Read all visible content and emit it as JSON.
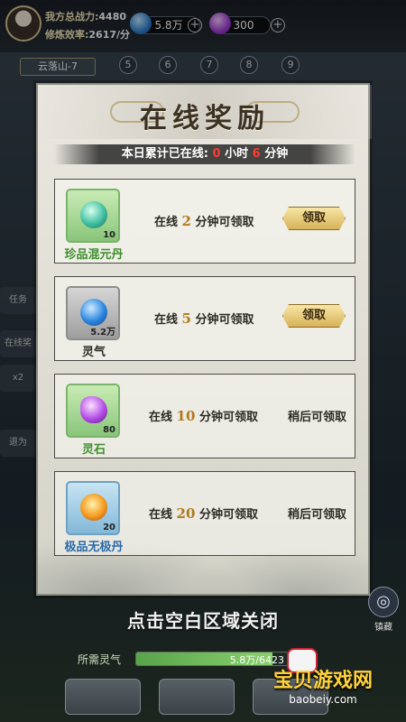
{
  "hud": {
    "power_label": "我方总战力:",
    "power_value": "4480",
    "rate_label": "修炼效率:",
    "rate_value": "2617/分",
    "spirit_amount": "5.8万",
    "stone_amount": "300",
    "plus_symbol": "+"
  },
  "stage": {
    "current": "云落山-7",
    "nodes": [
      "5",
      "6",
      "7",
      "8",
      "9"
    ]
  },
  "background": {
    "side_labels": [
      "任务",
      "在线奖",
      "x2",
      "退为"
    ],
    "close_hint": "点击空白区域关闭",
    "required_label": "所需灵气",
    "required_value": "5.8万/6423",
    "required_progress": 0.9,
    "right_icon_label": "镇藏"
  },
  "modal": {
    "title": "在线奖励",
    "online_prefix": "本日累计已在线:",
    "online_hours": "0",
    "hours_unit": "小时",
    "online_minutes": "6",
    "minutes_unit": "分钟",
    "rewards": [
      {
        "name": "珍品混元丹",
        "qty": "10",
        "name_color": "#3f8f2e",
        "task_pre": "在线",
        "task_num": "2",
        "task_post": "分钟可领取",
        "status": "claim",
        "claim_label": "领取",
        "icon": "green-pill-icon"
      },
      {
        "name": "灵气",
        "qty": "5.2万",
        "name_color": "#2c2a26",
        "task_pre": "在线",
        "task_num": "5",
        "task_post": "分钟可领取",
        "status": "claim",
        "claim_label": "领取",
        "icon": "blue-spirit-orb-icon"
      },
      {
        "name": "灵石",
        "qty": "80",
        "name_color": "#3f8f2e",
        "task_pre": "在线",
        "task_num": "10",
        "task_post": "分钟可领取",
        "status": "later",
        "later_label": "稍后可领取",
        "icon": "purple-spirit-stone-icon"
      },
      {
        "name": "极品无极丹",
        "qty": "20",
        "name_color": "#2a6aa8",
        "task_pre": "在线",
        "task_num": "20",
        "task_post": "分钟可领取",
        "status": "later",
        "later_label": "稍后可领取",
        "icon": "fire-pill-icon"
      }
    ]
  },
  "watermark": {
    "text": "宝贝游戏网",
    "url": "baobeiy.com"
  },
  "colors": {
    "accent_gold": "#d7b258",
    "highlight_red": "#ff3b30",
    "number_gold": "#b07a1c"
  }
}
